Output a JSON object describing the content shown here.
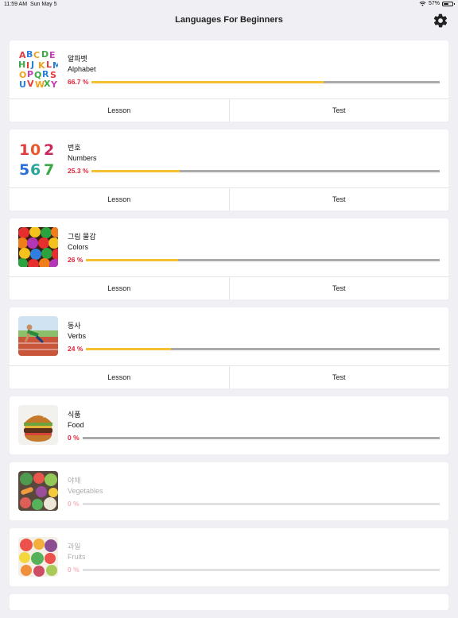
{
  "status": {
    "time": "11:59 AM",
    "date": "Sun May 5",
    "battery": "57%",
    "battery_level": 0.57
  },
  "header": {
    "title": "Languages For Beginners"
  },
  "actions": {
    "lesson": "Lesson",
    "test": "Test"
  },
  "topics": [
    {
      "native": "알파벳",
      "english": "Alphabet",
      "percent_label": "66.7 %",
      "progress": 0.667,
      "image": "alphabet-letters-image",
      "locked": false,
      "has_actions": true
    },
    {
      "native": "번호",
      "english": "Numbers",
      "percent_label": "25.3 %",
      "progress": 0.253,
      "image": "numbers-image",
      "locked": false,
      "has_actions": true
    },
    {
      "native": "그림 물감",
      "english": "Colors",
      "percent_label": "26 %",
      "progress": 0.26,
      "image": "candy-colors-image",
      "locked": false,
      "has_actions": true
    },
    {
      "native": "동사",
      "english": "Verbs",
      "percent_label": "24 %",
      "progress": 0.24,
      "image": "runner-image",
      "locked": false,
      "has_actions": true
    },
    {
      "native": "식품",
      "english": "Food",
      "percent_label": "0 %",
      "progress": 0,
      "image": "burger-image",
      "locked": false,
      "has_actions": false
    },
    {
      "native": "야채",
      "english": "Vegetables",
      "percent_label": "0 %",
      "progress": 0,
      "image": "vegetables-image",
      "locked": true,
      "has_actions": false
    },
    {
      "native": "과일",
      "english": "Fruits",
      "percent_label": "0 %",
      "progress": 0,
      "image": "fruits-image",
      "locked": true,
      "has_actions": false
    }
  ],
  "colors": {
    "background": "#efeff4",
    "percent": "#e0243a",
    "progress_fill": "#f5c133",
    "progress_track": "#aaaaaa"
  }
}
